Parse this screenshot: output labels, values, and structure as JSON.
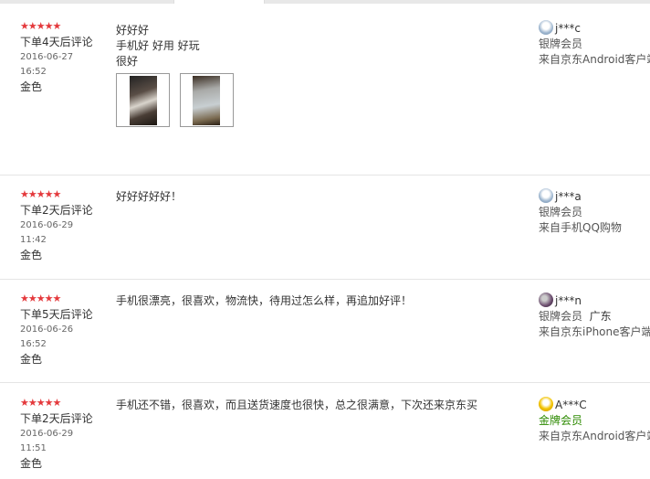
{
  "reviews": [
    {
      "stars": "★★★★★",
      "days": "下单4天后评论",
      "date": "2016-06-27",
      "time": "16:52",
      "color": "金色",
      "lines": [
        "好好好",
        "手机好 好用 好玩",
        "很好"
      ],
      "user": "j***c",
      "level": "银牌会员",
      "region": "",
      "source": "来自京东Android客户端"
    },
    {
      "stars": "★★★★★",
      "days": "下单2天后评论",
      "date": "2016-06-29",
      "time": "11:42",
      "color": "金色",
      "lines": [
        "好好好好好！"
      ],
      "user": "j***a",
      "level": "银牌会员",
      "region": "",
      "source": "来自手机QQ购物"
    },
    {
      "stars": "★★★★★",
      "days": "下单5天后评论",
      "date": "2016-06-26",
      "time": "16:52",
      "color": "金色",
      "lines": [
        "手机很漂亮，很喜欢，物流快，待用过怎么样，再追加好评！"
      ],
      "user": "j***n",
      "level": "银牌会员",
      "region": "广东",
      "source": "来自京东iPhone客户端"
    },
    {
      "stars": "★★★★★",
      "days": "下单2天后评论",
      "date": "2016-06-29",
      "time": "11:51",
      "color": "金色",
      "lines": [
        "手机还不错，很喜欢，而且送货速度也很快，总之很满意，下次还来京东买"
      ],
      "user": "A***C",
      "level": "金牌会员",
      "region": "",
      "source": "来自京东Android客户端"
    }
  ]
}
